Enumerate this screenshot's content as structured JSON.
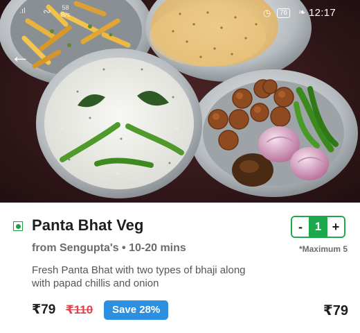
{
  "status_bar": {
    "signal": ".ıl",
    "speed_value": "58",
    "speed_unit": "B/s",
    "battery": "76",
    "time": "12:17"
  },
  "icons": {
    "back": "arrow-left-icon",
    "wifi": "wifi-icon",
    "alarm": "alarm-clock-icon",
    "leaf": "leaf-icon",
    "veg": "veg-indicator-icon"
  },
  "item": {
    "name": "Panta Bhat Veg",
    "meta": "from Sengupta's • 10-20 mins",
    "description": "Fresh Panta Bhat with two types of bhaji along with papad chillis and onion",
    "price": "₹79",
    "original_price": "₹110",
    "discount_label": "Save 28%",
    "total": "₹79"
  },
  "stepper": {
    "minus": "-",
    "quantity": "1",
    "plus": "+",
    "limit_note": "*Maximum 5"
  },
  "colors": {
    "veg_green": "#1a9e4a",
    "stepper_green": "#1ba94c",
    "discount_blue": "#2d8fe0",
    "strike_red": "#e0454f"
  }
}
